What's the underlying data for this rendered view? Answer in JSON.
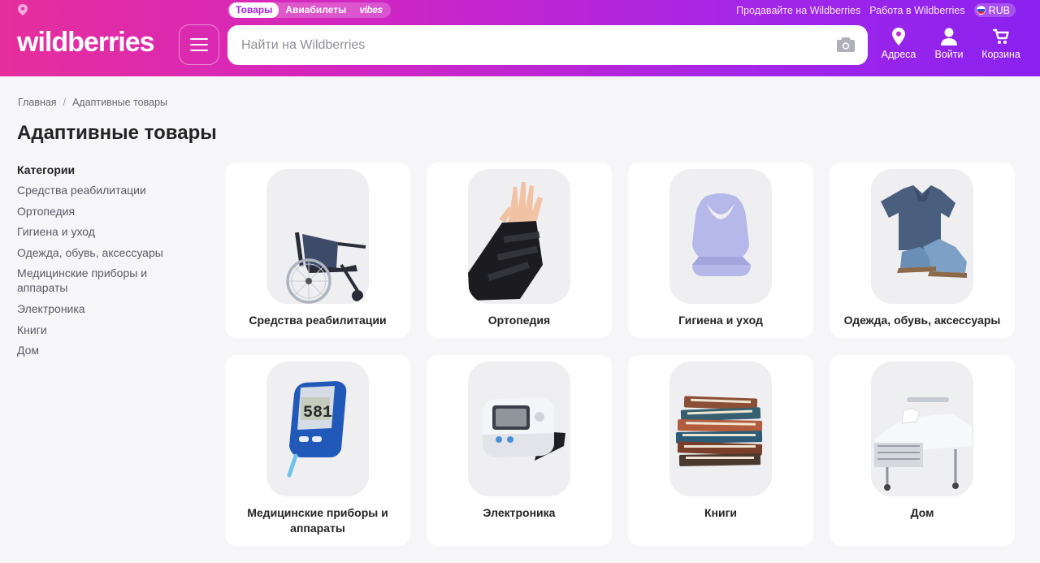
{
  "header": {
    "tabs": [
      "Товары",
      "Авиабилеты",
      "vibes"
    ],
    "links": [
      "Продавайте на Wildberries",
      "Работа в Wildberries"
    ],
    "currency": "RUB",
    "logo": "wildberries",
    "search_placeholder": "Найти на Wildberries",
    "nav": {
      "addresses": "Адреса",
      "login": "Войти",
      "cart": "Корзина"
    },
    "colors": {
      "gradient_start": "#e62e9c",
      "gradient_end": "#8a22f0",
      "active_tab_text": "#a626e6"
    }
  },
  "breadcrumb": [
    "Главная",
    "Адаптивные товары"
  ],
  "page_title": "Адаптивные товары",
  "sidebar": {
    "heading": "Категории",
    "items": [
      "Средства реабилитации",
      "Ортопедия",
      "Гигиена и уход",
      "Одежда, обувь, аксессуары",
      "Медицинские приборы и аппараты",
      "Электроника",
      "Книги",
      "Дом"
    ]
  },
  "categories": [
    {
      "label": "Средства реабилитации",
      "icon": "wheelchair-icon"
    },
    {
      "label": "Ортопедия",
      "icon": "wrist-brace-icon"
    },
    {
      "label": "Гигиена и уход",
      "icon": "bib-icon"
    },
    {
      "label": "Одежда, обувь, аксессуары",
      "icon": "shirt-shoes-icon"
    },
    {
      "label": "Медицинские приборы и аппараты",
      "icon": "glucometer-icon",
      "screen_text": "581"
    },
    {
      "label": "Электроника",
      "icon": "blood-pressure-monitor-icon"
    },
    {
      "label": "Книги",
      "icon": "books-icon"
    },
    {
      "label": "Дом",
      "icon": "hospital-bed-icon"
    }
  ]
}
